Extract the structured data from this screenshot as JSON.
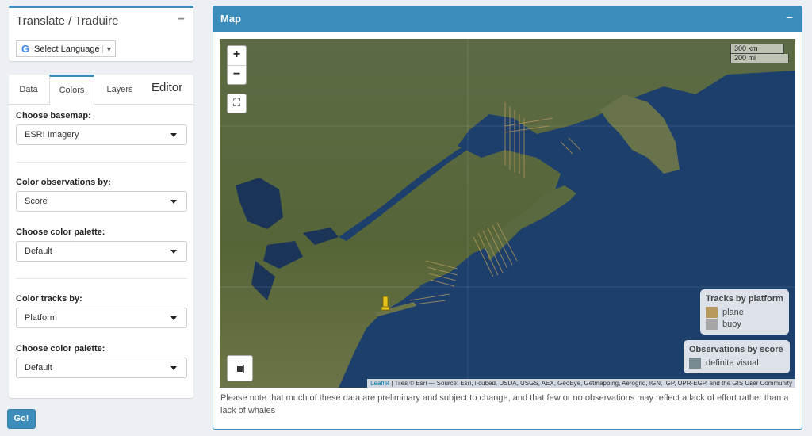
{
  "translate": {
    "title": "Translate / Traduire",
    "collapse_icon": "−",
    "google_logo": "G",
    "language_select": "Select Language",
    "language_caret": "▼"
  },
  "editor": {
    "tabs": [
      {
        "label": "Data",
        "active": false
      },
      {
        "label": "Colors",
        "active": true
      },
      {
        "label": "Layers",
        "active": false
      }
    ],
    "title": "Editor",
    "basemap": {
      "label": "Choose basemap:",
      "value": "ESRI Imagery"
    },
    "color_observations": {
      "label": "Color observations by:",
      "value": "Score"
    },
    "obs_palette": {
      "label": "Choose color palette:",
      "value": "Default"
    },
    "color_tracks": {
      "label": "Color tracks by:",
      "value": "Platform"
    },
    "track_palette": {
      "label": "Choose color palette:",
      "value": "Default"
    }
  },
  "go_button": "Go!",
  "map": {
    "title": "Map",
    "collapse_icon": "−",
    "zoom_in": "+",
    "zoom_out": "−",
    "fullscreen_icon": "⛶",
    "draw_icon": "▣",
    "scale": {
      "km": "300 km",
      "mi": "200 mi"
    },
    "tracks_legend": {
      "title": "Tracks by platform",
      "items": [
        {
          "label": "plane",
          "color": "#b8995c"
        },
        {
          "label": "buoy",
          "color": "#a6a6a6"
        }
      ]
    },
    "obs_legend": {
      "title": "Observations by score",
      "items": [
        {
          "label": "definite visual",
          "color": "#7a8a92"
        }
      ]
    },
    "attribution_link": "Leaflet",
    "attribution_text": " | Tiles © Esri — Source: Esri, i-cubed, USDA, USGS, AEX, GeoEye, Getmapping, Aerogrid, IGN, IGP, UPR-EGP, and the GIS User Community",
    "note": "Please note that much of these data are preliminary and subject to change, and that few or no observations may reflect a lack of effort rather than a lack of whales"
  },
  "colors": {
    "accent": "#3c8dbc",
    "ocean": "#1d3f6c",
    "land": "#56653a",
    "plane_track": "#b8995c",
    "buoy_marker": "#e8c21c"
  }
}
